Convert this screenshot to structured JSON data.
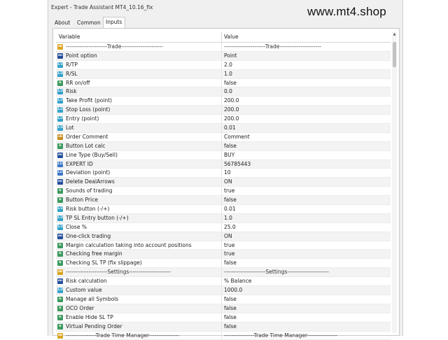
{
  "window": {
    "title": "Expert - Trade Assistant MT4_10.16_fix",
    "watermark": "www.mt4.shop"
  },
  "tabs": [
    {
      "label": "About",
      "active": false
    },
    {
      "label": "Common",
      "active": false
    },
    {
      "label": "Inputs",
      "active": true
    }
  ],
  "grid": {
    "columns": {
      "variable": "Variable",
      "value": "Value"
    },
    "rows": [
      {
        "kind": "sep",
        "icon": "ab",
        "name": "----------------------Trade----------------------",
        "value": "----------------------Trade----------------------"
      },
      {
        "kind": "enum",
        "icon": "en",
        "name": "Point option",
        "value": "Point"
      },
      {
        "kind": "dbl",
        "icon": "1/2",
        "name": "R/TP",
        "value": "2.0"
      },
      {
        "kind": "dbl",
        "icon": "1/2",
        "name": "R/SL",
        "value": "1.0"
      },
      {
        "kind": "bool",
        "icon": "b",
        "name": "RR on/off",
        "value": "false"
      },
      {
        "kind": "dbl",
        "icon": "1/2",
        "name": "Risk",
        "value": "0.0"
      },
      {
        "kind": "dbl",
        "icon": "1/2",
        "name": "Take Profit (point)",
        "value": "200.0"
      },
      {
        "kind": "dbl",
        "icon": "1/2",
        "name": "Stop Loss (point)",
        "value": "200.0"
      },
      {
        "kind": "dbl",
        "icon": "1/2",
        "name": "Entry (point)",
        "value": "200.0"
      },
      {
        "kind": "dbl",
        "icon": "1/2",
        "name": "Lot",
        "value": "0.01"
      },
      {
        "kind": "str",
        "icon": "ab",
        "name": "Order Comment",
        "value": "Comment"
      },
      {
        "kind": "bool",
        "icon": "b",
        "name": "Button Lot calc",
        "value": "false"
      },
      {
        "kind": "enum",
        "icon": "en",
        "name": "Line Type (Buy/Sell)",
        "value": "BUY"
      },
      {
        "kind": "int",
        "icon": "123",
        "name": "EXPERT ID",
        "value": "56785443"
      },
      {
        "kind": "int",
        "icon": "123",
        "name": "Deviation (point)",
        "value": "10"
      },
      {
        "kind": "enum",
        "icon": "en",
        "name": "Delete DealArrows",
        "value": "ON"
      },
      {
        "kind": "bool",
        "icon": "b",
        "name": "Sounds of trading",
        "value": "true"
      },
      {
        "kind": "bool",
        "icon": "b",
        "name": "Button Price",
        "value": "false"
      },
      {
        "kind": "dbl",
        "icon": "1/2",
        "name": "Risk button (-/+)",
        "value": "0.01"
      },
      {
        "kind": "dbl",
        "icon": "1/2",
        "name": "TP SL Entry button (-/+)",
        "value": "1.0"
      },
      {
        "kind": "dbl",
        "icon": "1/2",
        "name": "Close %",
        "value": "25.0"
      },
      {
        "kind": "enum",
        "icon": "en",
        "name": "One-click trading",
        "value": "ON"
      },
      {
        "kind": "bool",
        "icon": "b",
        "name": "Margin calculation taking into account positions",
        "value": "true"
      },
      {
        "kind": "bool",
        "icon": "b",
        "name": "Checking free margin",
        "value": "true"
      },
      {
        "kind": "bool",
        "icon": "b",
        "name": "Checking SL TP (fix slippage)",
        "value": "false"
      },
      {
        "kind": "sep",
        "icon": "ab",
        "name": "----------------------Settings----------------------",
        "value": "----------------------Settings----------------------"
      },
      {
        "kind": "enum",
        "icon": "en",
        "name": "Risk calculation",
        "value": "% Balance"
      },
      {
        "kind": "dbl",
        "icon": "1/2",
        "name": "Custom value",
        "value": "1000.0"
      },
      {
        "kind": "bool",
        "icon": "b",
        "name": "Manage all Symbols",
        "value": "false"
      },
      {
        "kind": "bool",
        "icon": "b",
        "name": "OCO Order",
        "value": "false"
      },
      {
        "kind": "bool",
        "icon": "b",
        "name": "Enable Hide SL TP",
        "value": "false"
      },
      {
        "kind": "bool",
        "icon": "b",
        "name": "Virtual Pending Order",
        "value": "false"
      },
      {
        "kind": "sep",
        "icon": "ab",
        "name": "----------------Trade Time Manager----------------",
        "value": "----------------Trade Time Manager----------------"
      }
    ]
  },
  "colors": {
    "separator_icon": "#d9a521",
    "int_icon": "#3a74c7",
    "double_icon": "#34a0c9",
    "bool_icon": "#3d9a5e",
    "enum_icon": "#244d9b",
    "string_icon": "#c98a1b"
  },
  "icons": {
    "sep": "separator-icon",
    "int": "integer-icon",
    "dbl": "double-icon",
    "bool": "boolean-icon",
    "enum": "enum-icon",
    "str": "string-icon"
  }
}
